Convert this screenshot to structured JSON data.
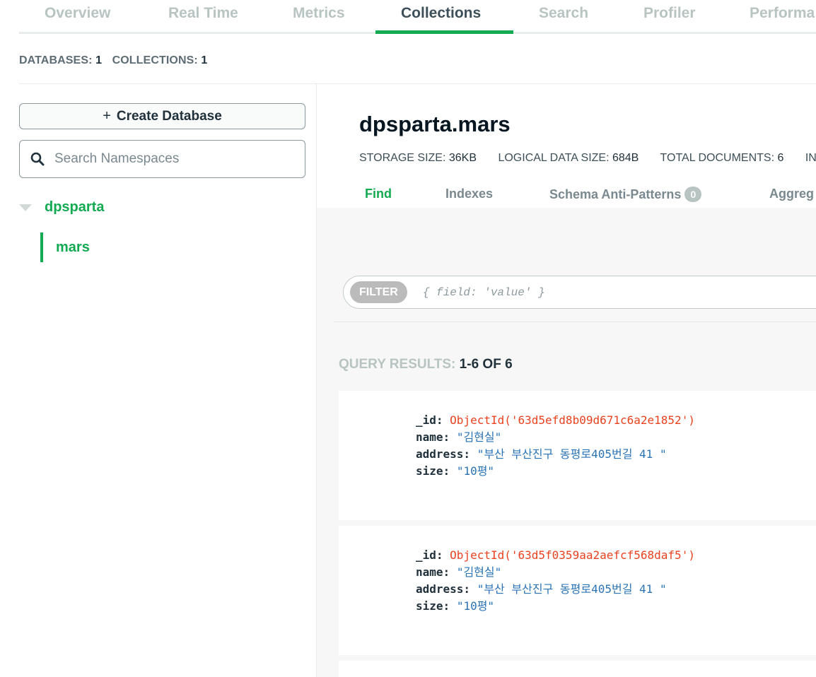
{
  "top_tabs": [
    {
      "label": "Overview",
      "active": false
    },
    {
      "label": "Real Time",
      "active": false
    },
    {
      "label": "Metrics",
      "active": false
    },
    {
      "label": "Collections",
      "active": true
    },
    {
      "label": "Search",
      "active": false
    },
    {
      "label": "Profiler",
      "active": false
    },
    {
      "label": "Performa",
      "active": false
    }
  ],
  "summary": {
    "databases_label": "DATABASES:",
    "databases_value": "1",
    "collections_label": "COLLECTIONS:",
    "collections_value": "1"
  },
  "sidebar": {
    "create_database_label": "Create Database",
    "search_placeholder": "Search Namespaces",
    "database": "dpsparta",
    "collection": "mars"
  },
  "collection": {
    "title": "dpsparta.mars",
    "stats": [
      {
        "label": "STORAGE SIZE:",
        "value": "36KB"
      },
      {
        "label": "LOGICAL DATA SIZE:",
        "value": "684B"
      },
      {
        "label": "TOTAL DOCUMENTS:",
        "value": "6"
      },
      {
        "label": "IN",
        "value": ""
      }
    ]
  },
  "sub_tabs": [
    {
      "label": "Find",
      "active": true
    },
    {
      "label": "Indexes",
      "active": false
    },
    {
      "label": "Schema Anti-Patterns",
      "badge": "0",
      "active": false
    },
    {
      "label": "Aggreg",
      "active": false
    }
  ],
  "filter": {
    "pill_label": "FILTER",
    "placeholder": "{ field: 'value' }"
  },
  "results": {
    "label": "QUERY RESULTS:",
    "count": "1-6 OF 6"
  },
  "documents": [
    {
      "id_key": "_id:",
      "id_value": "ObjectId('63d5efd8b09d671c6a2e1852')",
      "name_key": "name:",
      "name_value": "\"김현실\"",
      "address_key": "address:",
      "address_value": "\"부산 부산진구 동평로405번길 41 \"",
      "size_key": "size:",
      "size_value": "\"10평\""
    },
    {
      "id_key": "_id:",
      "id_value": "ObjectId('63d5f0359aa2aefcf568daf5')",
      "name_key": "name:",
      "name_value": "\"김현실\"",
      "address_key": "address:",
      "address_value": "\"부산 부산진구 동평로405번길 41 \"",
      "size_key": "size:",
      "size_value": "\"10평\""
    }
  ],
  "colors": {
    "accent": "#13aa52",
    "object_id": "#e8421f",
    "string_value": "#2a73b5"
  }
}
